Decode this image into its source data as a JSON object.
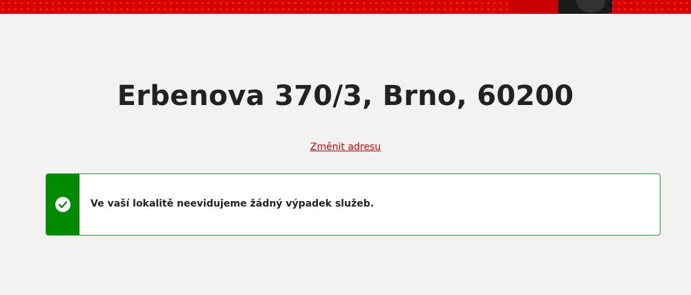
{
  "hero": {
    "image_icon": "hero-banner-image"
  },
  "address": {
    "title": "Erbenova 370/3, Brno, 60200",
    "change_link": "Změnit adresu"
  },
  "status": {
    "icon": "check-circle-icon",
    "message": "Ve vaší lokalitě neevidujeme žádný výpadek služeb.",
    "colors": {
      "accent": "#008a00",
      "border": "#2b9b2b",
      "brand_red": "#d90000"
    }
  }
}
